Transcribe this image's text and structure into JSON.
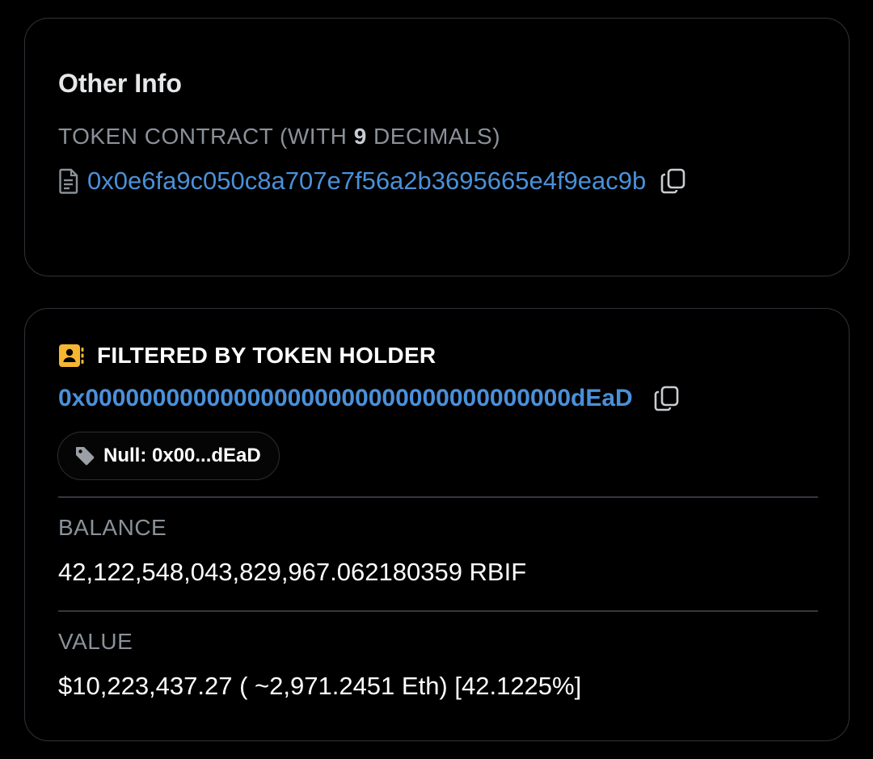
{
  "other_info": {
    "title": "Other Info",
    "contract_label_prefix": "TOKEN CONTRACT (WITH ",
    "decimals": "9",
    "contract_label_suffix": " DECIMALS)",
    "contract_address": "0x0e6fa9c050c8a707e7f56a2b3695665e4f9eac9b",
    "contract_icon": "document-icon",
    "copy_icon": "copy-icon"
  },
  "holder": {
    "title": "FILTERED BY TOKEN HOLDER",
    "title_icon": "contact-book-icon",
    "title_icon_color": "#f5b731",
    "address": "0x000000000000000000000000000000000000dEaD",
    "copy_icon": "copy-icon",
    "tag_icon": "tag-icon",
    "tag_label": "Null: 0x00...dEaD",
    "balance_label": "BALANCE",
    "balance_value": "42,122,548,043,829,967.062180359 RBIF",
    "value_label": "VALUE",
    "value_value": "$10,223,437.27 ( ~2,971.2451 Eth) [42.1225%]"
  },
  "colors": {
    "link": "#4a90d9",
    "muted": "#8a9199",
    "border": "#2e3338",
    "background": "#000000"
  }
}
